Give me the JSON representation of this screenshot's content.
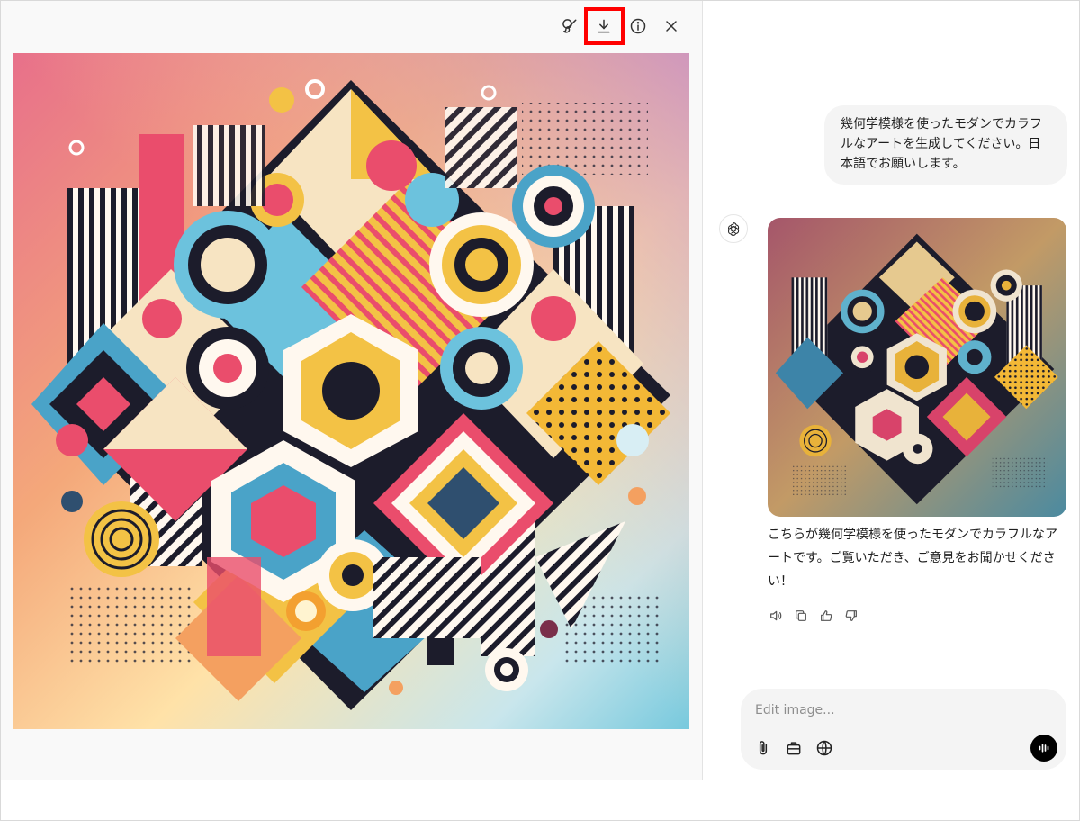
{
  "viewer": {
    "icons": [
      "edit-brush-icon",
      "download-icon",
      "info-icon",
      "close-icon"
    ]
  },
  "chat": {
    "user_message": "幾何学模様を使ったモダンでカラフルなアートを生成してください。日本語でお願いします。",
    "assistant_message": "こちらが幾何学模様を使ったモダンでカラフルなアートです。ご覧いただき、ご意見をお聞かせください！",
    "composer": {
      "placeholder": "Edit image..."
    }
  },
  "colors": {
    "highlight": "#ff0000",
    "bubble_bg": "#f4f4f4",
    "art_gradient": [
      "#e8708a",
      "#f4b56a",
      "#ffe8a6",
      "#bfe6ef",
      "#77c9dd"
    ]
  }
}
